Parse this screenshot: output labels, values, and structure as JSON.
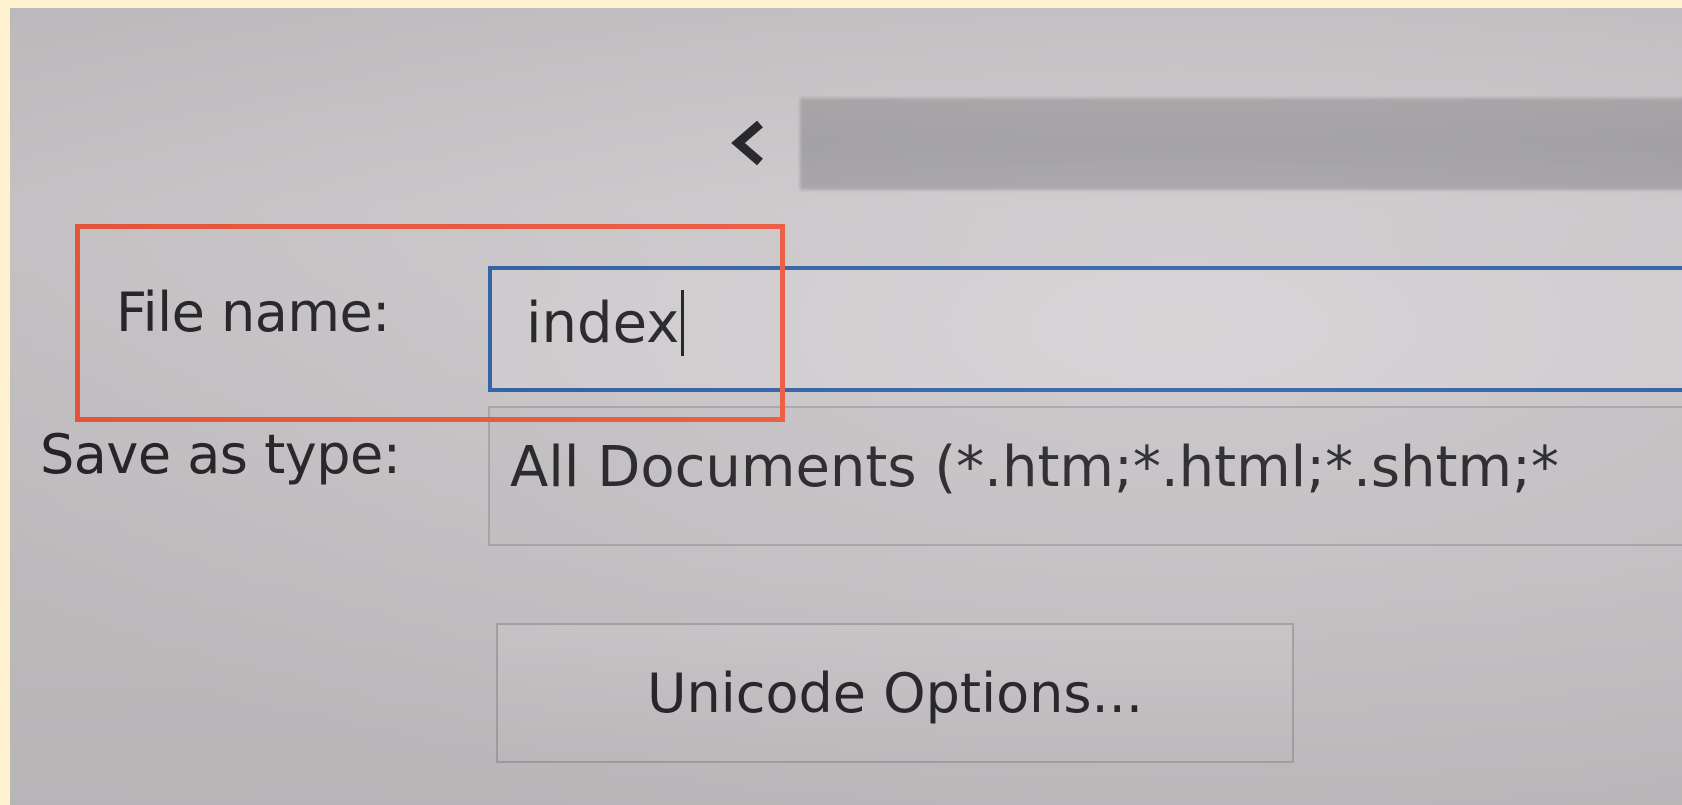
{
  "dialog": {
    "file_name_label": "File name:",
    "file_name_value": "index",
    "save_as_type_label": "Save as type:",
    "save_as_type_value": "All Documents (*.htm;*.html;*.shtm;*",
    "unicode_options_label": "Unicode Options..."
  },
  "icons": {
    "back": "chevron-left-icon"
  },
  "colors": {
    "highlight": "#f0563a",
    "input_focus_border": "#2c5fa6",
    "background": "#fdf1cf"
  }
}
